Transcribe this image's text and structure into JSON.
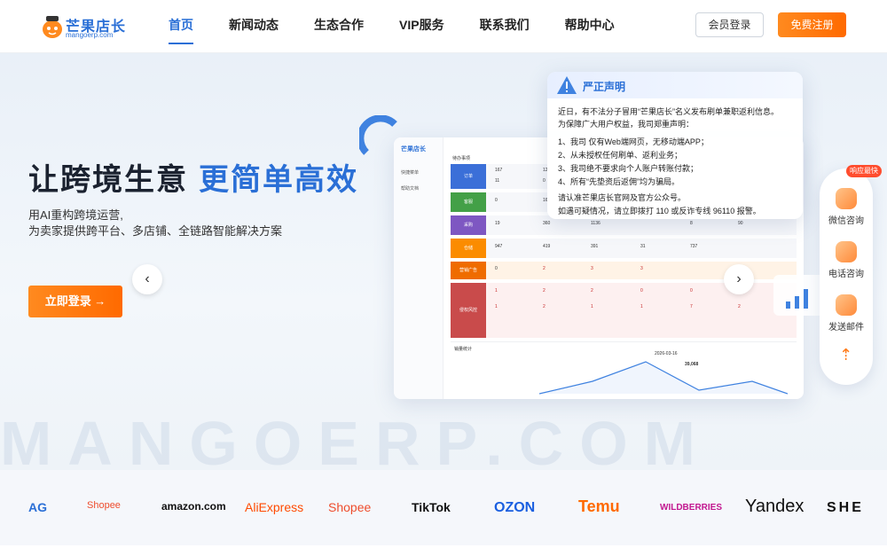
{
  "header": {
    "logo_name": "芒果店长",
    "logo_domain": "mangoerp.com",
    "nav": [
      "首页",
      "新闻动态",
      "生态合作",
      "VIP服务",
      "联系我们",
      "帮助中心"
    ],
    "login_label": "会员登录",
    "register_label": "免费注册"
  },
  "hero": {
    "title_plain": "让跨境生意",
    "title_highlight": "更简单高效",
    "subtitle_line1": "用AI重构跨境运营,",
    "subtitle_line2": "为卖家提供跨平台、多店铺、全链路智能解决方案",
    "cta_label": "立即登录 →",
    "watermark": "MANGOERP.COM"
  },
  "dashboard": {
    "logo": "芒果店长",
    "menu": [
      "快捷菜单",
      "帮助文档"
    ],
    "panel_title": "待办事项",
    "rows": [
      {
        "tag": "订单",
        "color": "#3b6fd8",
        "values": [
          "167",
          "12",
          "11",
          "0"
        ]
      },
      {
        "tag": "客服",
        "color": "#43a047",
        "values": [
          "0",
          "16"
        ]
      },
      {
        "tag": "采购",
        "color": "#7e57c2",
        "values": [
          "19",
          "360",
          "1136",
          "8",
          "90"
        ]
      },
      {
        "tag": "仓储",
        "color": "#fb8c00",
        "values": [
          "947",
          "419",
          "391",
          "31",
          "737"
        ]
      },
      {
        "tag": "营销广告",
        "color": "#ef6c00",
        "values": [
          "0",
          "2",
          "3",
          "3"
        ]
      },
      {
        "tag": "侵权风控",
        "color": "#c94b4b",
        "values": [
          "1",
          "2",
          "2",
          "0",
          "0",
          "2",
          "1",
          "2",
          "1",
          "1",
          "7",
          "2"
        ]
      }
    ],
    "chart_title": "销量统计",
    "chart_date": "2026-03-16",
    "chart_value": "39,068"
  },
  "notice": {
    "title": "严正声明",
    "lines": [
      "近日，有不法分子冒用“芒果店长”名义发布刷单兼职返利信息。",
      "为保障广大用户权益，我司郑重声明：",
      "1、我司 仅有Web端网页，无移动端APP；",
      "2、从未授权任何刷单、返利业务；",
      "3、我司绝不要求向个人账户转账付款；",
      "4、所有“先垫资后返佣”均为骗局。",
      "请认准芒果店长官网及官方公众号。",
      "如遇可疑情况，请立即拨打 110 或反诈专线 96110 报警。"
    ]
  },
  "float": {
    "badge": "响应最快",
    "items": [
      "微信咨询",
      "电话咨询",
      "发送邮件"
    ],
    "top_icon": "arrow-up-icon"
  },
  "brands": [
    "AG",
    "Shopee",
    "amazon.com",
    "AliExpress",
    "Shopee",
    "TikTok",
    "OZON",
    "Temu",
    "WILDBERRIES",
    "Yandex",
    "SHE"
  ]
}
